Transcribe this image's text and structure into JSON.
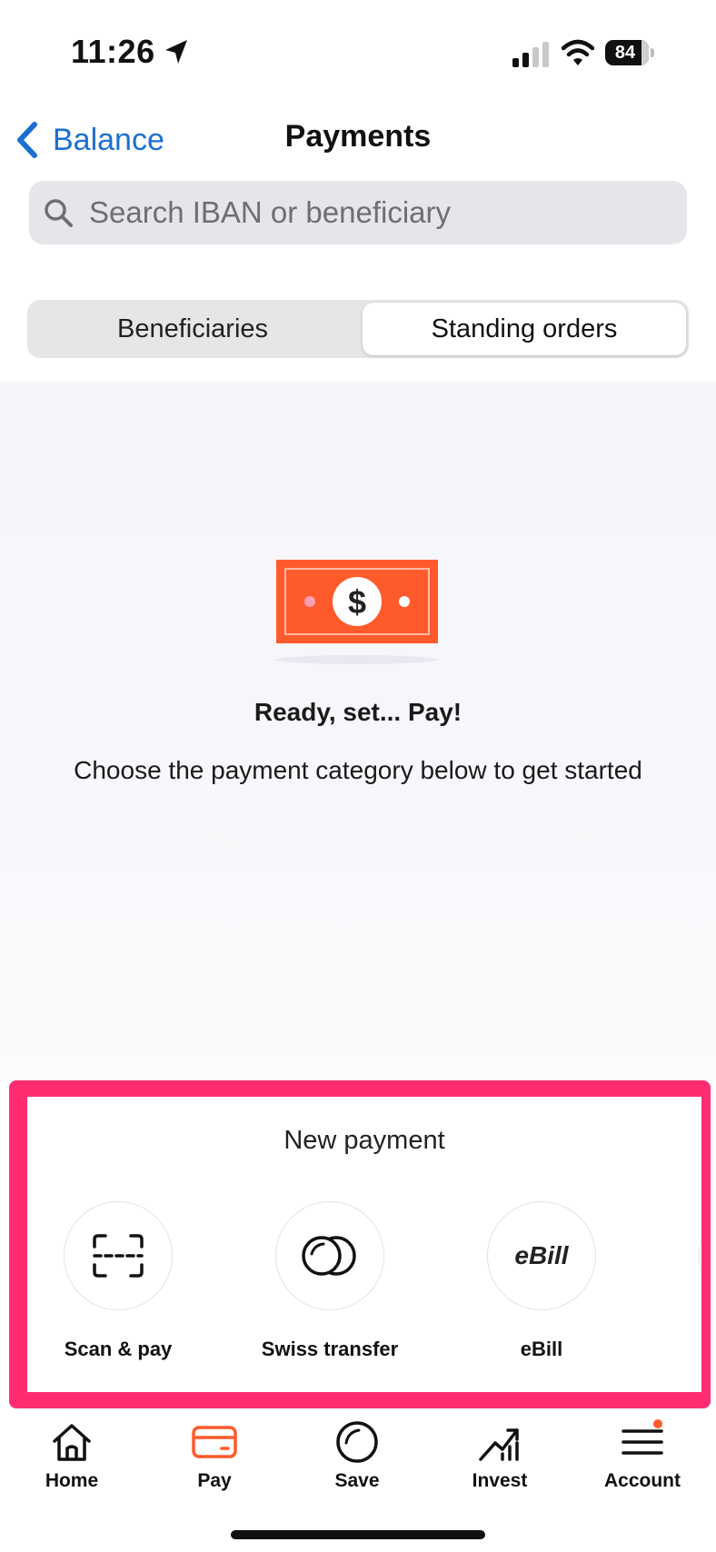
{
  "status_bar": {
    "time": "11:26",
    "battery": "84"
  },
  "nav": {
    "back_label": "Balance",
    "title": "Payments"
  },
  "search": {
    "placeholder": "Search IBAN or beneficiary"
  },
  "segmented": {
    "tabs": [
      {
        "label": "Beneficiaries",
        "selected": false
      },
      {
        "label": "Standing orders",
        "selected": true
      }
    ]
  },
  "empty_state": {
    "title": "Ready, set... Pay!",
    "subtitle": "Choose the payment category below to get started"
  },
  "new_payment": {
    "title": "New payment",
    "actions": [
      {
        "label": "Scan & pay",
        "icon": "scan-icon"
      },
      {
        "label": "Swiss transfer",
        "icon": "coins-icon"
      },
      {
        "label": "eBill",
        "icon": "ebill-icon",
        "icon_text": "eBill"
      }
    ]
  },
  "tabbar": {
    "items": [
      {
        "label": "Home",
        "icon": "home-icon",
        "active": false
      },
      {
        "label": "Pay",
        "icon": "card-icon",
        "active": true
      },
      {
        "label": "Save",
        "icon": "save-icon",
        "active": false
      },
      {
        "label": "Invest",
        "icon": "invest-icon",
        "active": false
      },
      {
        "label": "Account",
        "icon": "menu-icon",
        "active": false
      }
    ]
  },
  "colors": {
    "accent": "#ff5a2c",
    "link": "#1c6fd1",
    "highlight_frame": "#ff2d6f"
  }
}
